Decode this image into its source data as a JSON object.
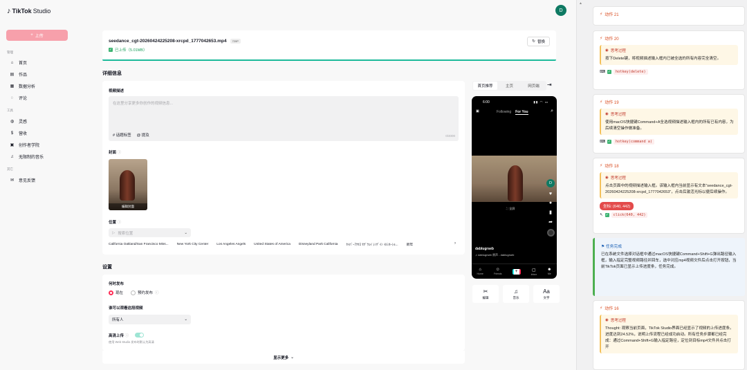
{
  "app": {
    "brand": "TikTok",
    "product": "Studio",
    "avatar_letter": "D"
  },
  "sidebar": {
    "upload_label": "上传",
    "section_manage": "管理",
    "section_tools": "工具",
    "section_other": "其它",
    "items": [
      {
        "label": "首页",
        "icon": "home-icon"
      },
      {
        "label": "作品",
        "icon": "posts-icon"
      },
      {
        "label": "数据分析",
        "icon": "analytics-icon"
      },
      {
        "label": "评论",
        "icon": "comments-icon"
      },
      {
        "label": "灵感",
        "icon": "bulb-icon"
      },
      {
        "label": "营收",
        "icon": "revenue-icon"
      },
      {
        "label": "创作者学院",
        "icon": "academy-icon"
      },
      {
        "label": "无限制的音乐",
        "icon": "music-icon"
      },
      {
        "label": "意见反馈",
        "icon": "feedback-icon"
      }
    ]
  },
  "file": {
    "name": "seedance_cgt-20260424225208-xrcpd_1777042653.mp4",
    "quality": "720P",
    "status": "已上传（5.01MB）",
    "replace_label": "替换",
    "progress": 1.0
  },
  "details": {
    "heading": "详细信息",
    "desc_label": "视频描述",
    "desc_placeholder": "在这里分享更多你创作的视频信息...",
    "hashtag_label": "# 话题标签",
    "mention_label": "@ 提及",
    "char_count": "0/4000",
    "cover_label": "封面",
    "cover_edit": "编辑封面",
    "location_label": "位置",
    "location_placeholder": "搜索位置",
    "locations": [
      "California Oakland/San Francisco Miss...",
      "New York City Center",
      "Los Angeles Angels",
      "Estados Unidos",
      "United States of America",
      "Disneyland Park California",
      "ｾｲﾊﾞｰｱｸｾｽ ｾｸﾞｳｪｲ ｼﾝｸﾞｲﾝ ｲﾙﾐﾈｰｼｮ...",
      "新年"
    ]
  },
  "settings": {
    "heading": "设置",
    "when_label": "何时发布",
    "now_label": "现在",
    "schedule_label": "预约发布",
    "who_label": "谁可以观看这段视频",
    "who_value": "所有人",
    "hd_label": "高清上传",
    "hd_hint": "使用 Web Studio 发布时默认为高清",
    "show_more": "显示更多"
  },
  "preview": {
    "tabs": [
      "首页推荐",
      "主页",
      "网页端"
    ],
    "time": "6:00",
    "following": "Following",
    "for_you": "For You",
    "fullscreen": "全屏",
    "username": "dablugrseb",
    "music": "♫ dablugrseb 原声 - dablugrseb",
    "nav": [
      "Home",
      "Friends",
      "",
      "Inbox",
      "Me"
    ],
    "tools": [
      {
        "label": "编辑",
        "icon": "scissors-icon"
      },
      {
        "label": "音乐",
        "icon": "music-note-icon"
      },
      {
        "label": "文字",
        "icon": "text-icon"
      }
    ]
  },
  "log": {
    "steps": [
      {
        "title": "动作 21"
      },
      {
        "title": "动作 20",
        "think_title": "思考过程",
        "think": "按下Delete键，将视频描述输入框内已被全选的所有内容完全清空。",
        "action": "hotkey(delete)"
      },
      {
        "title": "动作 19",
        "think_title": "思考过程",
        "think": "使用macOS快捷键Command+A全选视频描述输入框内的所有已有内容，为后续清空操作做准备。",
        "action": "hotkey(command a)"
      },
      {
        "title": "动作 18",
        "think_title": "思考过程",
        "think": "点击页面中的视频描述输入框。该输入框内当前显示有文本“seedance_cgt-20260424225208-xrcpd_1777042653”，点击后激活光标以便后续操作。",
        "coord": "坐标: (640, 442)",
        "action": "click(640, 442)"
      },
      {
        "title": "动作 16",
        "think_title": "思考过程",
        "think": "Thought: 观察当前页面，TikTok Studio界面已经显示了视频的上传进度条。进度达到24.52%，说明上传流程已经成功启动。所有任务步骤都已经完成：通过Command+Shift+G输入指定路径，定位到目标mp4文件并点击打开"
      }
    ],
    "done": {
      "title": "任务完成",
      "text": "已在系统文件选择对话框中通过macOS快捷键Command+Shift+G弹出路径输入框，输入指定完整视频路径并回车，选中对应mp4视频文件后点击打开按钮，当前TikTok页面已显示上传进度条，任务完成。"
    }
  }
}
